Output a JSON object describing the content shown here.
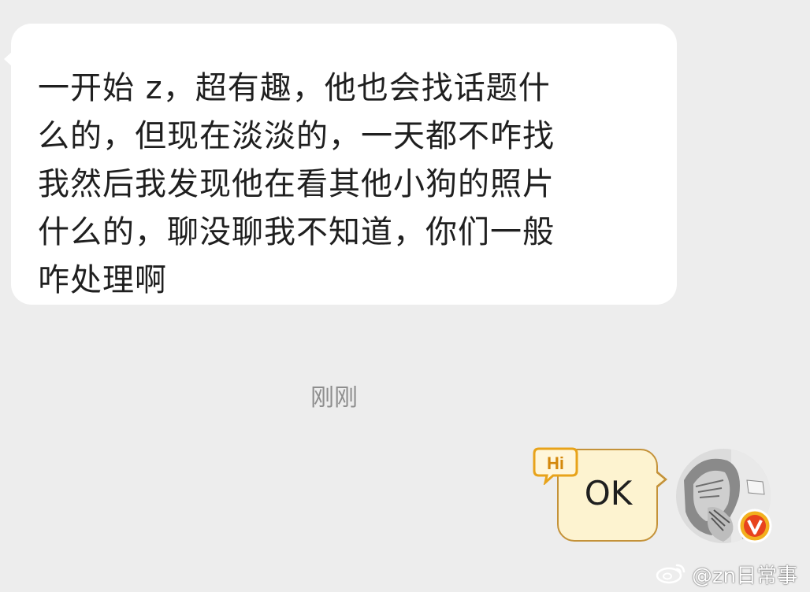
{
  "incoming_message": {
    "lines": [
      "一开始 z，超有趣，他也会找话题什",
      "么的，但现在淡淡的，一天都不咋找",
      "我然后我发现他在看其他小狗的照片",
      "什么的，聊没聊我不知道，你们一般",
      "咋处理啊"
    ]
  },
  "timestamp": "刚刚",
  "outgoing_message": {
    "text": "OK",
    "badge_text": "Hi"
  },
  "avatar": {
    "badge_icon": "verified-v-badge"
  },
  "watermark": {
    "text": "@zn日常事",
    "icon": "weibo-logo-icon"
  },
  "colors": {
    "background": "#ededed",
    "incoming_bubble": "#ffffff",
    "outgoing_bubble": "#fdf3d0",
    "outgoing_border": "#c49239",
    "badge_orange": "#e8a31a"
  }
}
